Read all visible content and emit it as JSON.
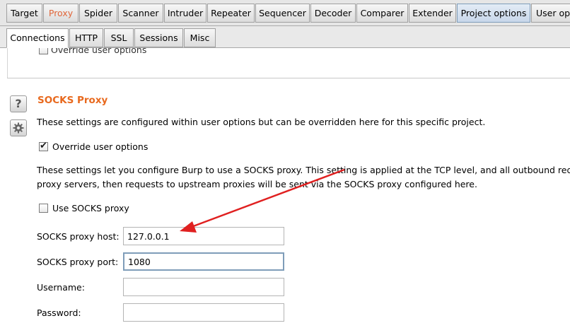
{
  "top_tabs": [
    {
      "label": "Target"
    },
    {
      "label": "Proxy"
    },
    {
      "label": "Spider"
    },
    {
      "label": "Scanner"
    },
    {
      "label": "Intruder"
    },
    {
      "label": "Repeater"
    },
    {
      "label": "Sequencer"
    },
    {
      "label": "Decoder"
    },
    {
      "label": "Comparer"
    },
    {
      "label": "Extender"
    },
    {
      "label": "Project options"
    },
    {
      "label": "User op"
    }
  ],
  "sub_tabs": [
    {
      "label": "Connections"
    },
    {
      "label": "HTTP"
    },
    {
      "label": "SSL"
    },
    {
      "label": "Sessions"
    },
    {
      "label": "Misc"
    }
  ],
  "previous_section": {
    "override_label": "Override user options"
  },
  "socks": {
    "icon_help": "help-icon",
    "icon_settings": "gear-icon",
    "title": "SOCKS Proxy",
    "intro": "These settings are configured within user options but can be overridden here for this specific project.",
    "override_label": "Override user options",
    "override_checked": true,
    "description_line1": "These settings let you configure Burp to use a SOCKS proxy. This setting is applied at the TCP level, and all outbound requests wi",
    "description_line2": "proxy servers, then requests to upstream proxies will be sent via the SOCKS proxy configured here.",
    "use_socks_label": "Use SOCKS proxy",
    "use_socks_checked": false,
    "host_label": "SOCKS proxy host:",
    "host_value": "127.0.0.1",
    "port_label": "SOCKS proxy port:",
    "port_value": "1080",
    "username_label": "Username:",
    "username_value": "",
    "password_label": "Password:",
    "password_value": ""
  },
  "colors": {
    "accent_orange": "#e8691e",
    "arrow_red": "#e02020"
  }
}
